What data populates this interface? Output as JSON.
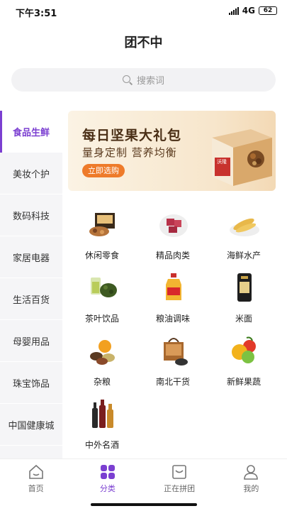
{
  "status_bar": {
    "time": "下午3:51",
    "network": "4G",
    "battery": "62"
  },
  "header": {
    "title": "团不中"
  },
  "search": {
    "placeholder": "搜索词"
  },
  "sidebar": {
    "items": [
      {
        "label": "食品生鲜",
        "active": true
      },
      {
        "label": "美妆个护"
      },
      {
        "label": "数码科技"
      },
      {
        "label": "家居电器"
      },
      {
        "label": "生活百货"
      },
      {
        "label": "母婴用品"
      },
      {
        "label": "珠宝饰品"
      },
      {
        "label": "中国健康城"
      }
    ]
  },
  "banner": {
    "title": "每日坚果大礼包",
    "subtitle": "量身定制 营养均衡",
    "button": "立即选购",
    "brand": "沃隆"
  },
  "categories": [
    {
      "label": "休闲零食",
      "icon": "snacks-icon"
    },
    {
      "label": "精品肉类",
      "icon": "meat-icon"
    },
    {
      "label": "海鲜水产",
      "icon": "seafood-icon"
    },
    {
      "label": "茶叶饮品",
      "icon": "tea-icon"
    },
    {
      "label": "粮油调味",
      "icon": "oil-icon"
    },
    {
      "label": "米面",
      "icon": "rice-icon"
    },
    {
      "label": "杂粮",
      "icon": "grains-icon"
    },
    {
      "label": "南北干货",
      "icon": "dried-goods-icon"
    },
    {
      "label": "新鲜果蔬",
      "icon": "fruits-icon"
    },
    {
      "label": "中外名酒",
      "icon": "liquor-icon"
    }
  ],
  "tab_bar": {
    "tabs": [
      {
        "label": "首页",
        "icon": "home-icon"
      },
      {
        "label": "分类",
        "icon": "category-icon",
        "active": true
      },
      {
        "label": "正在拼团",
        "icon": "group-buy-icon"
      },
      {
        "label": "我的",
        "icon": "profile-icon"
      }
    ]
  },
  "colors": {
    "accent": "#7b3fd1",
    "banner_button": "#ee7b2a"
  }
}
